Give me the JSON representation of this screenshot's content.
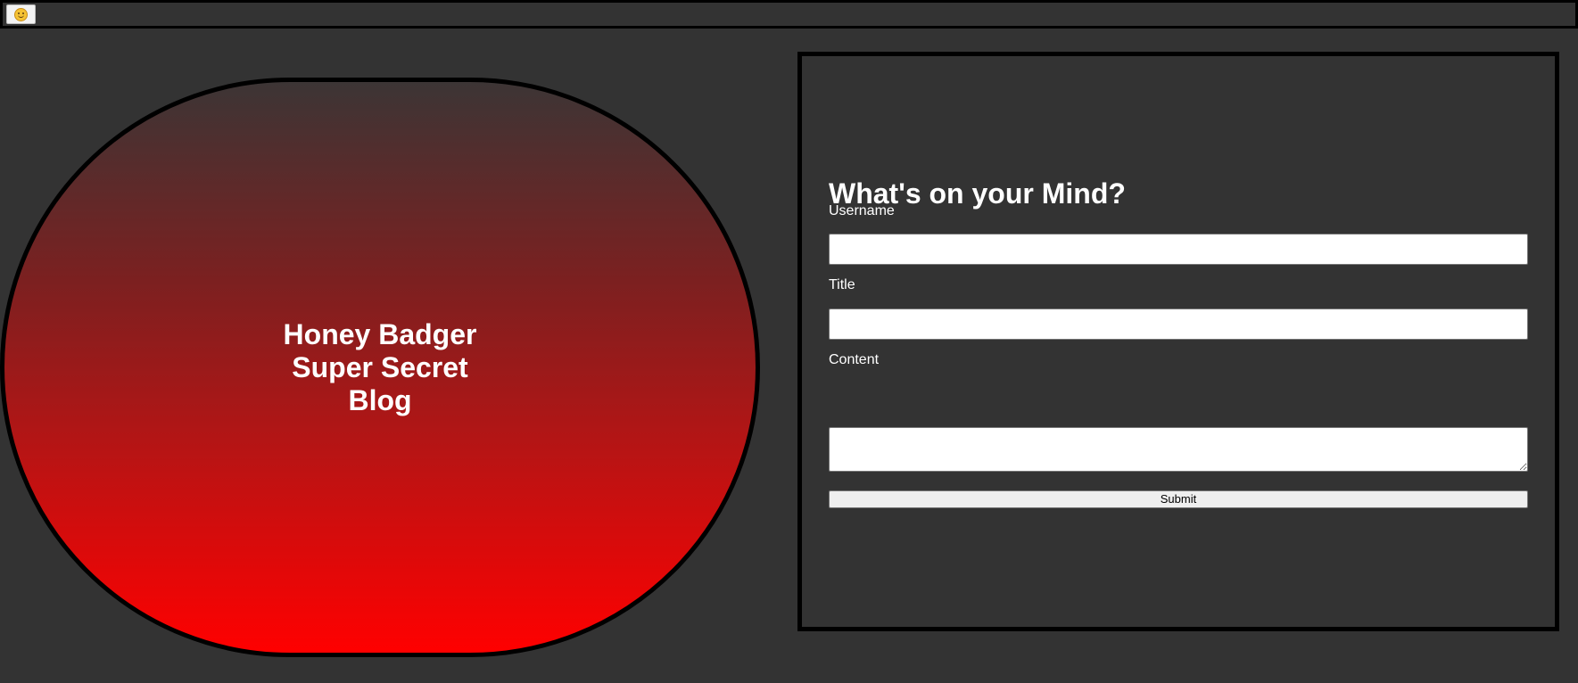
{
  "toolbar": {
    "emoji_button_icon": "smiley-face-icon"
  },
  "banner": {
    "title": "Honey Badger Super Secret Blog",
    "gradient_colors": [
      "#3c3535",
      "#ff0000"
    ],
    "border_color": "#000000"
  },
  "form": {
    "heading": "What's on your Mind?",
    "username_label": "Username",
    "username_value": "",
    "title_label": "Title",
    "title_value": "",
    "content_label": "Content",
    "content_value": "",
    "submit_label": "Submit"
  },
  "colors": {
    "page_background": "#333333",
    "text": "#ffffff",
    "input_background": "#ffffff",
    "button_background": "#efefef"
  }
}
